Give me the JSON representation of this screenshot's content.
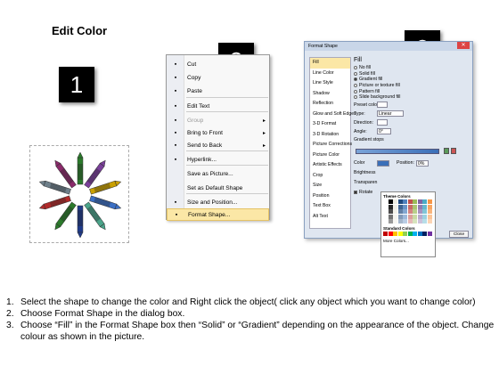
{
  "title": "Edit Color",
  "steps": [
    "1",
    "2",
    "3"
  ],
  "context_menu": {
    "items": [
      {
        "icon": "cut-icon",
        "label": "Cut",
        "state": "normal"
      },
      {
        "icon": "copy-icon",
        "label": "Copy",
        "state": "normal"
      },
      {
        "icon": "paste-icon",
        "label": "Paste",
        "state": "normal"
      },
      {
        "icon": "edit-text-icon",
        "label": "Edit Text",
        "state": "normal"
      },
      {
        "icon": "group-icon",
        "label": "Group",
        "state": "disabled",
        "submenu": true
      },
      {
        "icon": "bring-to-front-icon",
        "label": "Bring to Front",
        "state": "normal",
        "submenu": true
      },
      {
        "icon": "send-to-back-icon",
        "label": "Send to Back",
        "state": "normal",
        "submenu": true
      },
      {
        "icon": "hyperlink-icon",
        "label": "Hyperlink...",
        "state": "normal"
      },
      {
        "icon": "",
        "label": "Save as Picture...",
        "state": "normal"
      },
      {
        "icon": "",
        "label": "Set as Default Shape",
        "state": "normal"
      },
      {
        "icon": "size-position-icon",
        "label": "Size and Position...",
        "state": "normal"
      },
      {
        "icon": "format-shape-icon",
        "label": "Format Shape...",
        "state": "highlighted"
      }
    ]
  },
  "dialog": {
    "title": "Format Shape",
    "close_label": "Close",
    "categories": [
      "Fill",
      "Line Color",
      "Line Style",
      "Shadow",
      "Reflection",
      "Glow and Soft Edges",
      "3-D Format",
      "3-D Rotation",
      "Picture Corrections",
      "Picture Color",
      "Artistic Effects",
      "Crop",
      "Size",
      "Position",
      "Text Box",
      "Alt Text"
    ],
    "selected_category": "Fill",
    "pane_heading": "Fill",
    "fill_options": [
      "No fill",
      "Solid fill",
      "Gradient fill",
      "Picture or texture fill",
      "Pattern fill",
      "Slide background fill"
    ],
    "selected_fill": "Gradient fill",
    "fields": {
      "preset_label": "Preset colors:",
      "type_label": "Type:",
      "type_value": "Linear",
      "direction_label": "Direction:",
      "angle_label": "Angle:",
      "angle_value": "0°",
      "gradient_stops_label": "Gradient stops",
      "color_label": "Color",
      "position_label": "Position:",
      "position_value": "0%",
      "brightness_label": "Brightness",
      "transparency_label": "Transparen",
      "rotate_label": "Rotate"
    },
    "palette": {
      "theme_label": "Theme Colors",
      "standard_label": "Standard Colors",
      "more_label": "More Colors...",
      "theme_colors": [
        "#ffffff",
        "#000000",
        "#eeece1",
        "#1f497d",
        "#4f81bd",
        "#c0504d",
        "#9bbb59",
        "#8064a2",
        "#4bacc6",
        "#f79646"
      ],
      "standard_colors": [
        "#c00000",
        "#ff0000",
        "#ffc000",
        "#ffff00",
        "#92d050",
        "#00b050",
        "#00b0f0",
        "#0070c0",
        "#002060",
        "#7030a0"
      ]
    }
  },
  "crayons": [
    {
      "color": "#2b7a2b"
    },
    {
      "color": "#7a3f9a"
    },
    {
      "color": "#caa000"
    },
    {
      "color": "#3b6fc4"
    },
    {
      "color": "#4aa48a"
    },
    {
      "color": "#1f3a8a"
    },
    {
      "color": "#2b7a2b"
    },
    {
      "color": "#b02a2a"
    },
    {
      "color": "#6e7f8a"
    },
    {
      "color": "#8a2a6a"
    }
  ],
  "instructions": [
    {
      "num": "1.",
      "text": "Select the shape to change the color and Right click the object( click any object which you want to change color)"
    },
    {
      "num": "2.",
      "text": "Choose Format Shape in the dialog box."
    },
    {
      "num": "3.",
      "text": "Choose “Fill” in the Format Shape box then “Solid” or “Gradient” depending on the appearance of the object. Change colour as shown in the picture."
    }
  ]
}
